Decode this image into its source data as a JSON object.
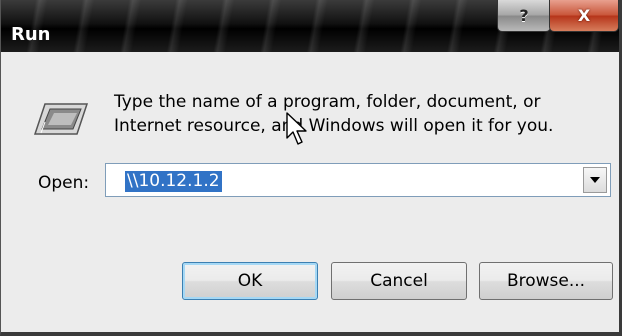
{
  "window": {
    "title": "Run",
    "help_label": "?",
    "close_label": "X"
  },
  "dialog": {
    "description_line1": "Type the name of a program, folder, document, or",
    "description_line2": "Internet resource, and Windows will open it for you.",
    "open_label": "Open:",
    "open_value": "\\\\10.12.1.2"
  },
  "buttons": {
    "ok": "OK",
    "cancel": "Cancel",
    "browse": "Browse..."
  },
  "colors": {
    "selection": "#3173c6",
    "close": "#c9573b"
  },
  "icons": {
    "run": "run-icon",
    "dropdown": "chevron-down-icon",
    "pointer": "mouse-pointer-icon"
  }
}
